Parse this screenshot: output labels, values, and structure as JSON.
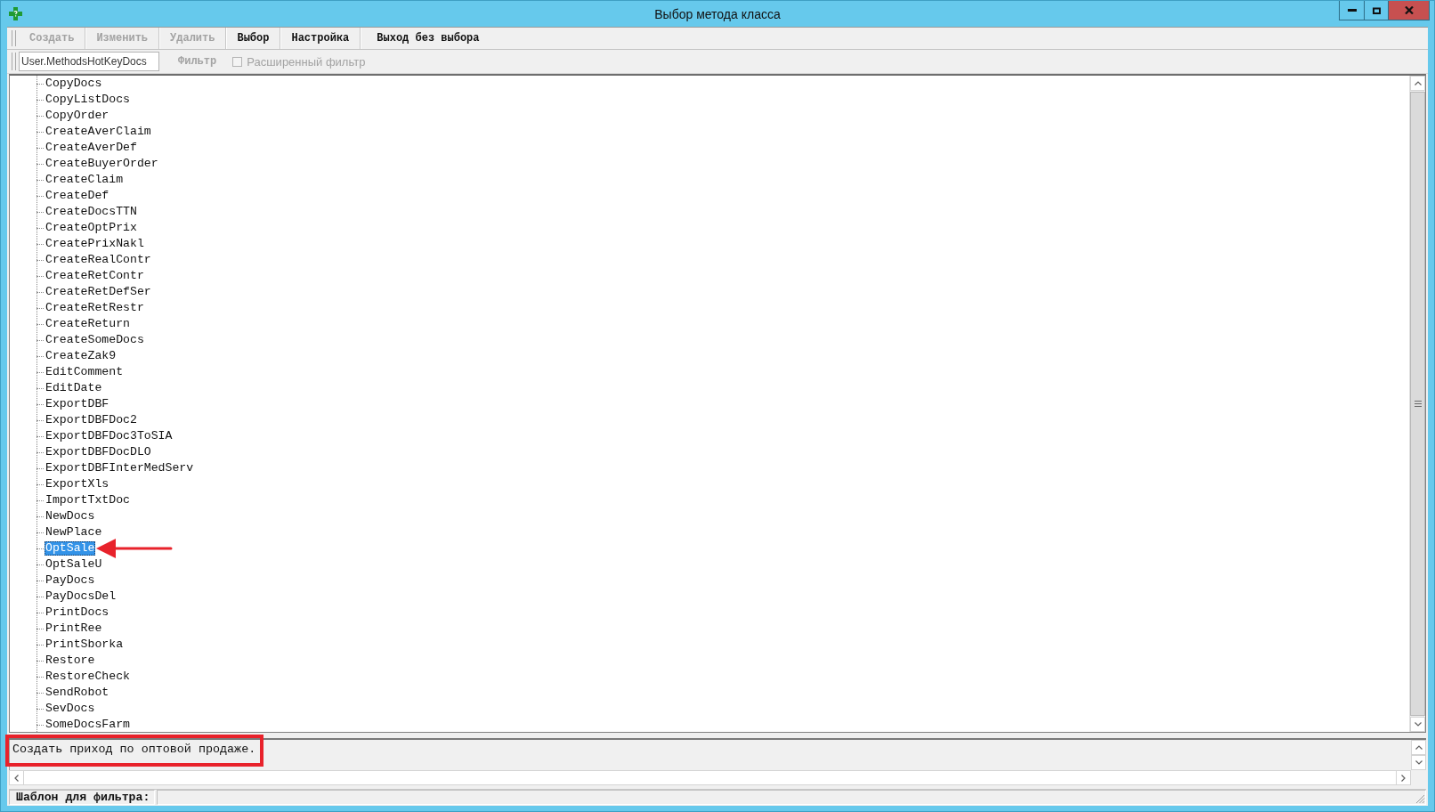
{
  "window": {
    "title": "Выбор метода класса"
  },
  "toolbar": {
    "buttons": [
      {
        "label": "Создать",
        "disabled": true
      },
      {
        "label": "Изменить",
        "disabled": true
      },
      {
        "label": "Удалить",
        "disabled": true
      },
      {
        "label": "Выбор",
        "disabled": false
      },
      {
        "label": "Настройка",
        "disabled": false
      },
      {
        "label": "Выход без выбора",
        "disabled": false
      }
    ]
  },
  "filter_bar": {
    "class_field": {
      "value": "User.MethodsHotKeyDocs"
    },
    "filter_button": {
      "label": "Фильтр",
      "disabled": true
    },
    "extended_filter": {
      "label": "Расширенный фильтр",
      "checked": false,
      "disabled": true
    }
  },
  "tree": {
    "items": [
      {
        "label": "CopyDocs",
        "selected": false
      },
      {
        "label": "CopyListDocs",
        "selected": false
      },
      {
        "label": "CopyOrder",
        "selected": false
      },
      {
        "label": "CreateAverClaim",
        "selected": false
      },
      {
        "label": "CreateAverDef",
        "selected": false
      },
      {
        "label": "CreateBuyerOrder",
        "selected": false
      },
      {
        "label": "CreateClaim",
        "selected": false
      },
      {
        "label": "CreateDef",
        "selected": false
      },
      {
        "label": "CreateDocsTTN",
        "selected": false
      },
      {
        "label": "CreateOptPrix",
        "selected": false
      },
      {
        "label": "CreatePrixNakl",
        "selected": false
      },
      {
        "label": "CreateRealContr",
        "selected": false
      },
      {
        "label": "CreateRetContr",
        "selected": false
      },
      {
        "label": "CreateRetDefSer",
        "selected": false
      },
      {
        "label": "CreateRetRestr",
        "selected": false
      },
      {
        "label": "CreateReturn",
        "selected": false
      },
      {
        "label": "CreateSomeDocs",
        "selected": false
      },
      {
        "label": "CreateZak9",
        "selected": false
      },
      {
        "label": "EditComment",
        "selected": false
      },
      {
        "label": "EditDate",
        "selected": false
      },
      {
        "label": "ExportDBF",
        "selected": false
      },
      {
        "label": "ExportDBFDoc2",
        "selected": false
      },
      {
        "label": "ExportDBFDoc3ToSIA",
        "selected": false
      },
      {
        "label": "ExportDBFDocDLO",
        "selected": false
      },
      {
        "label": "ExportDBFInterMedServ",
        "selected": false
      },
      {
        "label": "ExportXls",
        "selected": false
      },
      {
        "label": "ImportTxtDoc",
        "selected": false
      },
      {
        "label": "NewDocs",
        "selected": false
      },
      {
        "label": "NewPlace",
        "selected": false
      },
      {
        "label": "OptSale",
        "selected": true
      },
      {
        "label": "OptSaleU",
        "selected": false
      },
      {
        "label": "PayDocs",
        "selected": false
      },
      {
        "label": "PayDocsDel",
        "selected": false
      },
      {
        "label": "PrintDocs",
        "selected": false
      },
      {
        "label": "PrintRee",
        "selected": false
      },
      {
        "label": "PrintSborka",
        "selected": false
      },
      {
        "label": "Restore",
        "selected": false
      },
      {
        "label": "RestoreCheck",
        "selected": false
      },
      {
        "label": "SendRobot",
        "selected": false
      },
      {
        "label": "SevDocs",
        "selected": false
      },
      {
        "label": "SomeDocsFarm",
        "selected": false
      }
    ]
  },
  "description": {
    "text": "Создать приход по оптовой продаже."
  },
  "status_bar": {
    "label": "Шаблон для фильтра:"
  }
}
